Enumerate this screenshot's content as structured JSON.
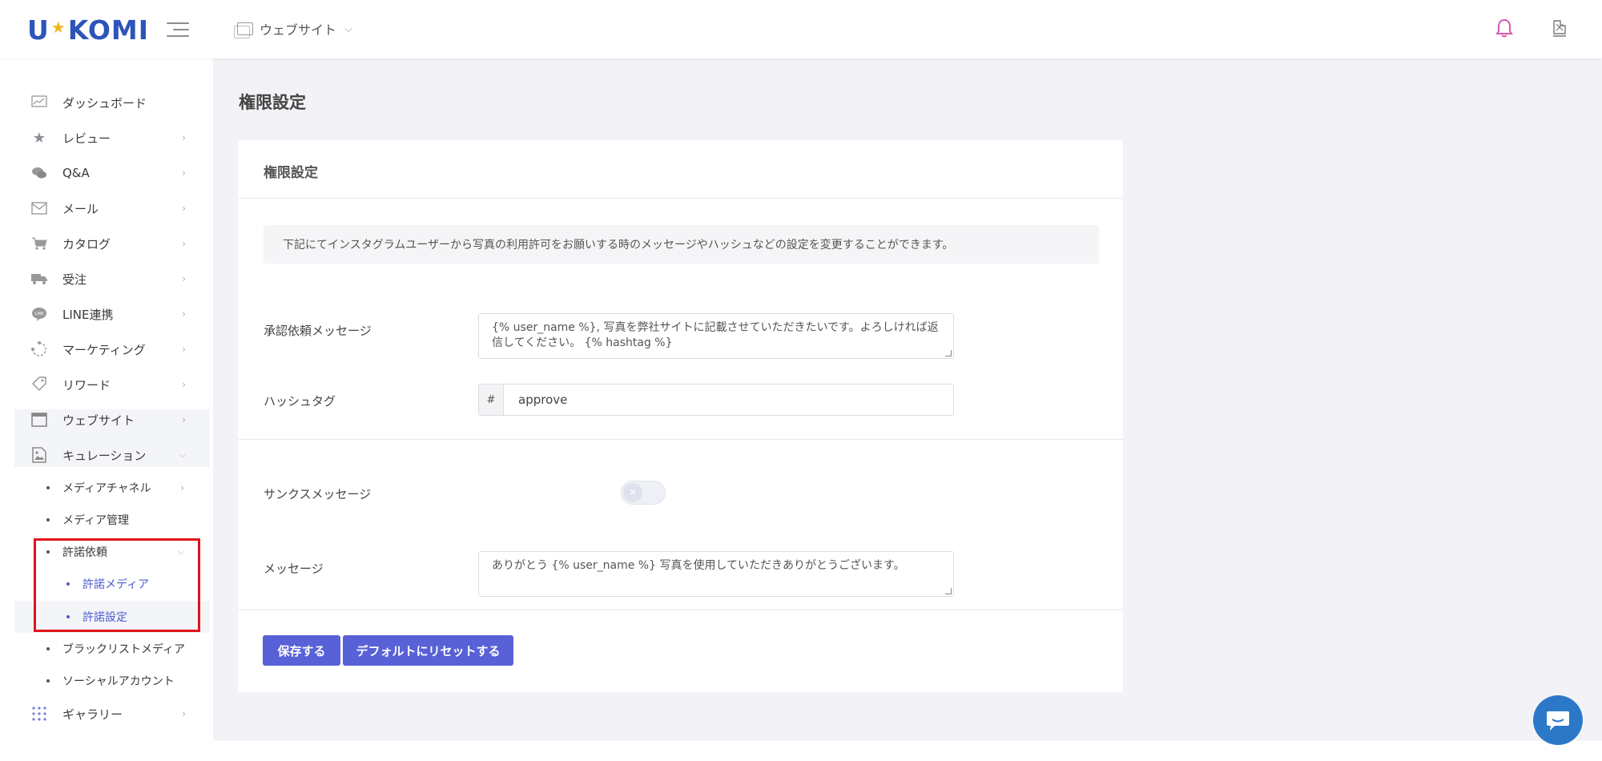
{
  "brand": {
    "logo_left": "U",
    "logo_star": "★",
    "logo_right": "KOMI"
  },
  "header": {
    "site_select_label": "ウェブサイト",
    "chevron": "⌵"
  },
  "sidebar": {
    "items": [
      {
        "label": "ダッシュボード",
        "icon": "chart-icon"
      },
      {
        "label": "レビュー",
        "icon": "star-icon"
      },
      {
        "label": "Q&A",
        "icon": "chat-bubbles-icon"
      },
      {
        "label": "メール",
        "icon": "envelope-icon"
      },
      {
        "label": "カタログ",
        "icon": "cart-icon"
      },
      {
        "label": "受注",
        "icon": "truck-icon"
      },
      {
        "label": "LINE連携",
        "icon": "line-icon"
      },
      {
        "label": "マーケティング",
        "icon": "cycle-icon"
      },
      {
        "label": "リワード",
        "icon": "tag-icon"
      },
      {
        "label": "ウェブサイト",
        "icon": "window-icon"
      },
      {
        "label": "キュレーション",
        "icon": "image-icon"
      }
    ],
    "curation_sub": {
      "media_channel": "メディアチャネル",
      "media_manage": "メディア管理",
      "permission_request": "許諾依頼",
      "permission_media": "許諾メディア",
      "permission_settings": "許諾設定",
      "blacklist_media": "ブラックリストメディア",
      "social_account": "ソーシャルアカウント"
    },
    "gallery": {
      "label": "ギャラリー",
      "icon": "grid-dots-icon"
    }
  },
  "page": {
    "title": "権限設定"
  },
  "card": {
    "title": "権限設定",
    "info": "下記にてインスタグラムユーザーから写真の利用許可をお願いする時のメッセージやハッシュなどの設定を変更することができます。",
    "approval_message_label": "承認依頼メッセージ",
    "approval_message_value": "{% user_name %}, 写真を弊社サイトに記載させていただきたいです。よろしければ返信してください。 {% hashtag %}",
    "hashtag_label": "ハッシュタグ",
    "hashtag_prefix": "#",
    "hashtag_value": "approve",
    "thanks_label": "サンクスメッセージ",
    "thanks_enabled": false,
    "message_label": "メッセージ",
    "message_value": "ありがとう {% user_name %} 写真を使用していただきありがとうございます。",
    "save_button": "保存する",
    "reset_button": "デフォルトにリセットする"
  },
  "colors": {
    "accent": "#5861d6",
    "brand": "#2d55b8",
    "highlight_box": "#e0141a",
    "chat": "#2c78c8"
  }
}
